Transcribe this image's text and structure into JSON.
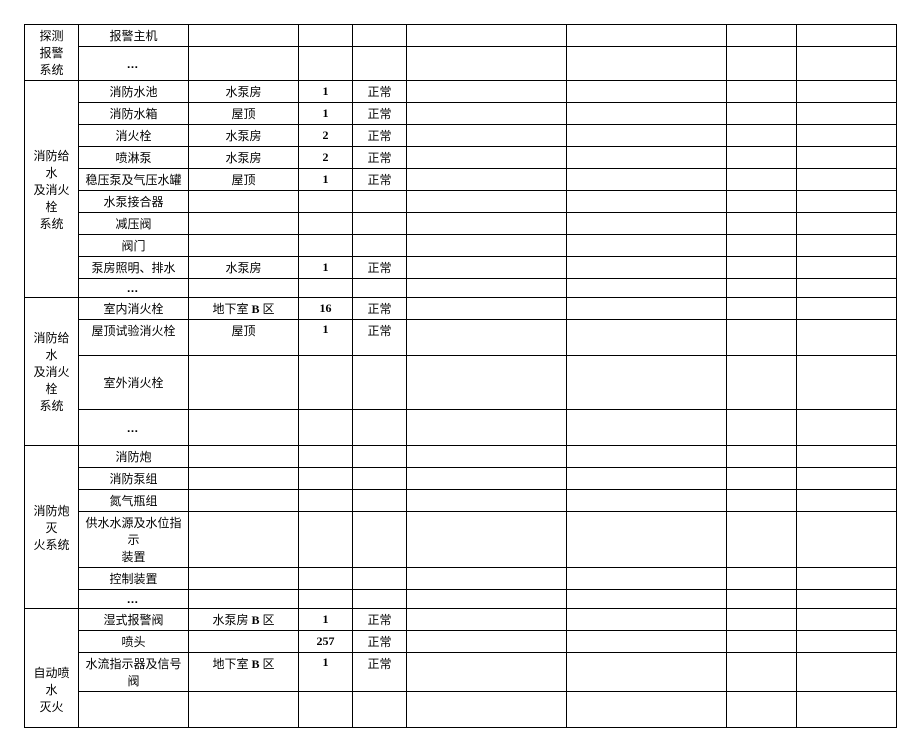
{
  "systems": [
    {
      "name": "探测\n报警\n系统",
      "rows": [
        {
          "item": "报警主机",
          "loc": "",
          "qty": "",
          "status": ""
        },
        {
          "item": "…",
          "loc": "",
          "qty": "",
          "status": "",
          "ellipsis": true,
          "tall": "tall3"
        }
      ]
    },
    {
      "name": "消防给水\n及消火栓\n系统",
      "rows": [
        {
          "item": "消防水池",
          "loc": "水泵房",
          "qty": "1",
          "status": "正常"
        },
        {
          "item": "消防水箱",
          "loc": "屋顶",
          "qty": "1",
          "status": "正常"
        },
        {
          "item": "消火栓",
          "loc": "水泵房",
          "qty": "2",
          "status": "正常"
        },
        {
          "item": "喷淋泵",
          "loc": "水泵房",
          "qty": "2",
          "status": "正常"
        },
        {
          "item": "稳压泵及气压水罐",
          "loc": "屋顶",
          "qty": "1",
          "status": "正常"
        },
        {
          "item": "水泵接合器",
          "loc": "",
          "qty": "",
          "status": ""
        },
        {
          "item": "减压阀",
          "loc": "",
          "qty": "",
          "status": ""
        },
        {
          "item": "阀门",
          "loc": "",
          "qty": "",
          "status": ""
        },
        {
          "item": "泵房照明、排水",
          "loc": "水泵房",
          "qty": "1",
          "status": "正常"
        },
        {
          "item": "…",
          "loc": "",
          "qty": "",
          "status": "",
          "ellipsis": true
        }
      ]
    },
    {
      "name": "消防给水\n及消火栓\n系统",
      "rows": [
        {
          "item": "室内消火栓",
          "loc": "地下室 B 区",
          "qty": "16",
          "status": "正常",
          "locBold": true
        },
        {
          "item": "屋顶试验消火栓",
          "loc": "屋顶",
          "qty": "1",
          "status": "正常",
          "tall": "tall2",
          "valignTop": true
        },
        {
          "item": "室外消火栓",
          "loc": "",
          "qty": "",
          "status": "",
          "tall": "tall"
        },
        {
          "item": "…",
          "loc": "",
          "qty": "",
          "status": "",
          "ellipsis": true,
          "tall": "tall2"
        }
      ]
    },
    {
      "name": "消防炮灭\n火系统",
      "rows": [
        {
          "item": "消防炮",
          "loc": "",
          "qty": "",
          "status": ""
        },
        {
          "item": "消防泵组",
          "loc": "",
          "qty": "",
          "status": ""
        },
        {
          "item": "氮气瓶组",
          "loc": "",
          "qty": "",
          "status": ""
        },
        {
          "item": "供水水源及水位指示\n装置",
          "loc": "",
          "qty": "",
          "status": "",
          "tall": "tall2"
        },
        {
          "item": "控制装置",
          "loc": "",
          "qty": "",
          "status": ""
        },
        {
          "item": "…",
          "loc": "",
          "qty": "",
          "status": "",
          "ellipsis": true
        }
      ]
    },
    {
      "name": "自动喷水\n灭火",
      "rows": [
        {
          "item": "湿式报警阀",
          "loc": "水泵房 B 区",
          "qty": "1",
          "status": "正常",
          "locBold": true
        },
        {
          "item": "喷头",
          "loc": "",
          "qty": "257",
          "status": "正常"
        },
        {
          "item": "水流指示器及信号阀",
          "loc": "地下室 B 区",
          "qty": "1",
          "status": "正常",
          "locBold": true,
          "valignTop": true
        },
        {
          "item": "",
          "loc": "",
          "qty": "",
          "status": "",
          "tall": "tall2"
        }
      ],
      "sysValignBottom": true
    }
  ]
}
